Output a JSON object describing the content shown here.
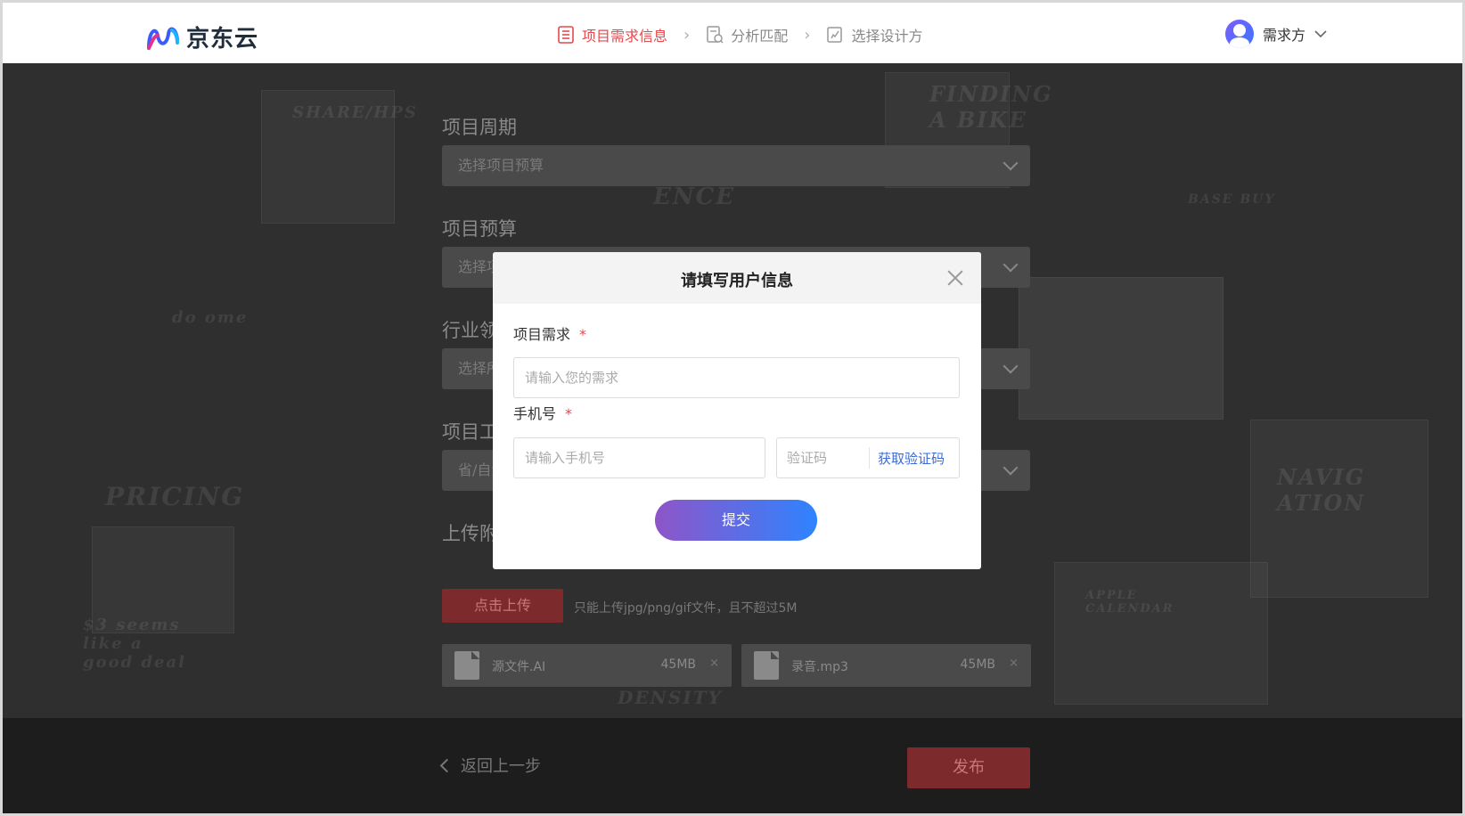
{
  "header": {
    "logo_text": "京东云",
    "steps": [
      {
        "label": "项目需求信息",
        "active": true,
        "icon": "list-doc-icon"
      },
      {
        "label": "分析匹配",
        "active": false,
        "icon": "doc-scan-icon"
      },
      {
        "label": "选择设计方",
        "active": false,
        "icon": "doc-edit-icon"
      }
    ],
    "user": {
      "name": "需求方",
      "icon": "avatar-icon"
    }
  },
  "form": {
    "fields": [
      {
        "label": "项目周期",
        "placeholder": "选择项目预算"
      },
      {
        "label": "项目预算",
        "placeholder": "选择项目预算"
      },
      {
        "label": "行业领域",
        "placeholder": "选择所属行业"
      },
      {
        "label": "项目工作地",
        "placeholder": "省/自治区/直辖市"
      }
    ],
    "upload": {
      "label": "上传附件",
      "button": "点击上传",
      "hint": "只能上传jpg/png/gif文件，且不超过5M"
    },
    "files": [
      {
        "name": "源文件.AI",
        "size": "45MB",
        "icon": "paperclip-icon"
      },
      {
        "name": "录音.mp3",
        "size": "45MB",
        "icon": "music-note-icon"
      }
    ],
    "back": "返回上一步",
    "publish": "发布"
  },
  "background_scribbles": [
    "SHARE/HPS",
    "FINDING A BIKE",
    "CONVENI ENCE",
    "PRICING",
    "do ome",
    "$3 seems like a good deal",
    "DENSITY",
    "NAVIG ATION",
    "BASE BUY",
    "APPLE CALENDAR"
  ],
  "modal": {
    "title": "请填写用户信息",
    "project_label": "项目需求",
    "project_placeholder": "请输入您的需求",
    "phone_label": "手机号",
    "phone_placeholder": "请输入手机号",
    "code_placeholder": "验证码",
    "get_code": "获取验证码",
    "submit": "提交",
    "required_mark": "*"
  }
}
